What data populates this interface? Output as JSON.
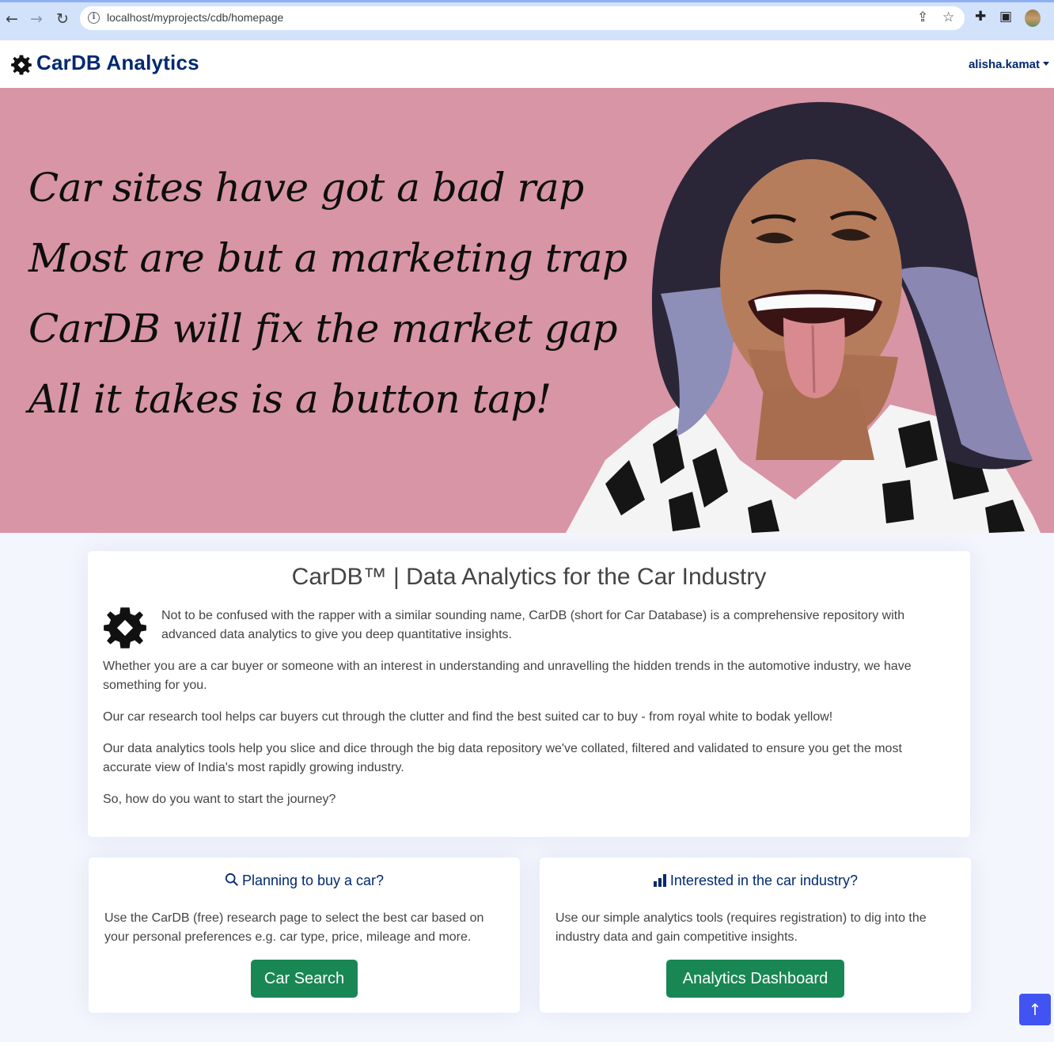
{
  "browser": {
    "url": "localhost/myprojects/cdb/homepage"
  },
  "navbar": {
    "brand": "CarDB Analytics",
    "user": "alisha.kamat"
  },
  "hero": {
    "lines": [
      "Car sites have got a bad rap",
      "Most are but a marketing trap",
      "CarDB will fix the market gap",
      "All it takes is a button tap!"
    ],
    "background_color": "#d895a5"
  },
  "intro": {
    "title": "CarDB™ | Data Analytics for the Car Industry",
    "paragraphs": [
      "Not to be confused with the rapper with a similar sounding name, CarDB (short for Car Database) is a comprehensive repository with advanced data analytics to give you deep quantitative insights.",
      "Whether you are a car buyer or someone with an interest in understanding and unravelling the hidden trends in the automotive industry, we have something for you.",
      "Our car research tool helps car buyers cut through the clutter and find the best suited car to buy - from royal white to bodak yellow!",
      "Our data analytics tools help you slice and dice through the big data repository we've collated, filtered and validated to ensure you get the most accurate view of India's most rapidly growing industry.",
      "So, how do you want to start the journey?"
    ]
  },
  "cards": {
    "buy": {
      "title": "Planning to buy a car?",
      "text": "Use the CarDB (free) research page to select the best car based on your personal preferences e.g. car type, price, mileage and more.",
      "button": "Car Search"
    },
    "industry": {
      "title": "Interested in the car industry?",
      "text": "Use our simple analytics tools (requires registration) to dig into the industry data and gain competitive insights.",
      "button": "Analytics Dashboard"
    }
  },
  "colors": {
    "brand": "#012970",
    "button": "#198754",
    "back_to_top": "#4154f1"
  }
}
